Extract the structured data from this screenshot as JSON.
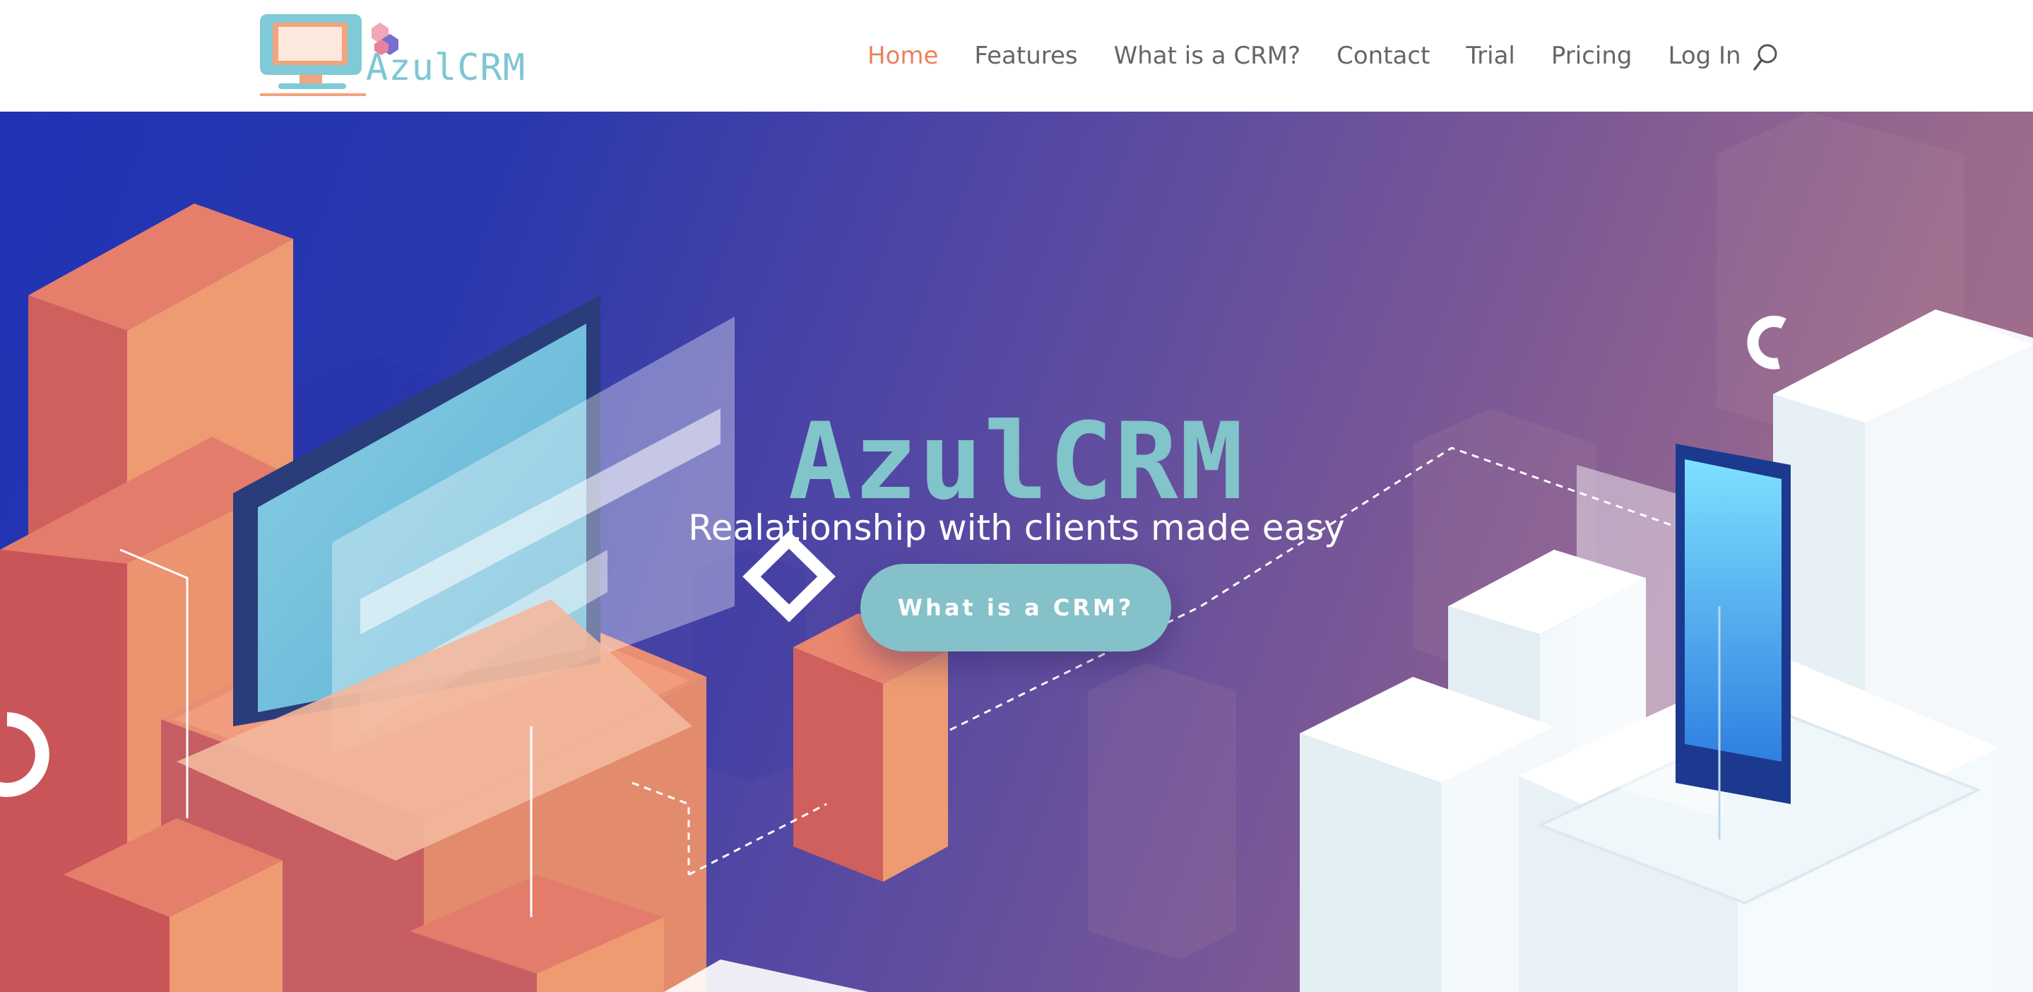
{
  "site": {
    "logo_text": "AzulCRM",
    "logo_icon": "computer-monitor-logo-icon"
  },
  "nav": {
    "items": [
      {
        "label": "Home",
        "active": true
      },
      {
        "label": "Features",
        "active": false
      },
      {
        "label": "What is a CRM?",
        "active": false
      },
      {
        "label": "Contact",
        "active": false
      },
      {
        "label": "Trial",
        "active": false
      },
      {
        "label": "Pricing",
        "active": false
      },
      {
        "label": "Log In",
        "active": false
      }
    ],
    "search_icon": "search-icon"
  },
  "hero": {
    "title": "AzulCRM",
    "subtitle": "Realationship with clients made easy",
    "button_label": "What is a CRM?"
  },
  "colors": {
    "accent": "#e9825c",
    "nav_text": "#666666",
    "brand_teal": "#81c4c9",
    "hero_gradient_start": "#1f33b4",
    "hero_gradient_end": "#a7728a"
  }
}
